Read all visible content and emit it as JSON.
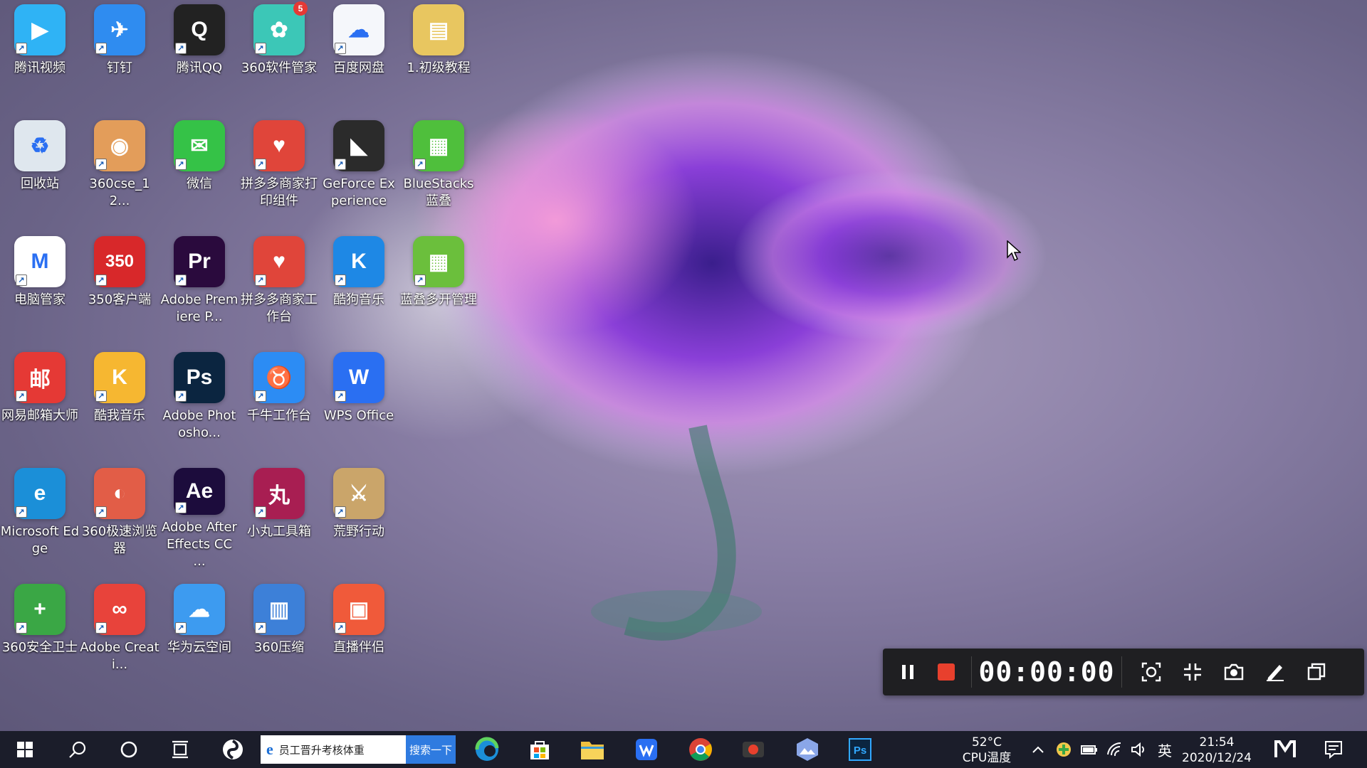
{
  "desktop": {
    "icons": [
      {
        "label": "腾讯视频",
        "glyph": "▶",
        "color": "#2fb3f5",
        "icon": "tencent-video-icon"
      },
      {
        "label": "钉钉",
        "glyph": "✈",
        "color": "#2f8cf0",
        "icon": "dingtalk-icon"
      },
      {
        "label": "腾讯QQ",
        "glyph": "Q",
        "color": "#222222",
        "icon": "qq-penguin-icon"
      },
      {
        "label": "360软件管家",
        "glyph": "✿",
        "color": "#3cc7b7",
        "icon": "360-software-manager-icon",
        "badge": "5"
      },
      {
        "label": "百度网盘",
        "glyph": "☁",
        "color": "#f5f7fb",
        "icon": "baidu-netdisk-icon"
      },
      {
        "label": "1.初级教程",
        "glyph": "▤",
        "color": "#e8c660",
        "icon": "folder-icon"
      },
      {
        "label": "回收站",
        "glyph": "♻",
        "color": "#dfe7ee",
        "icon": "recycle-bin-icon"
      },
      {
        "label": "360cse_12...",
        "glyph": "◉",
        "color": "#e39d5a",
        "icon": "archive-icon"
      },
      {
        "label": "微信",
        "glyph": "✉",
        "color": "#35c247",
        "icon": "wechat-icon"
      },
      {
        "label": "拼多多商家打印组件",
        "glyph": "♥",
        "color": "#e0453a",
        "icon": "pinduoduo-print-icon"
      },
      {
        "label": "GeForce Experience",
        "glyph": "◣",
        "color": "#2b2b2b",
        "icon": "geforce-icon"
      },
      {
        "label": "BlueStacks 蓝叠",
        "glyph": "▦",
        "color": "#4fbf3c",
        "icon": "bluestacks-icon"
      },
      {
        "label": "电脑管家",
        "glyph": "M",
        "color": "#ffffff",
        "icon": "pc-manager-icon"
      },
      {
        "label": "350客户端",
        "glyph": "350",
        "color": "#d8282a",
        "icon": "350-client-icon"
      },
      {
        "label": "Adobe Premiere P...",
        "glyph": "Pr",
        "color": "#2a0a3d",
        "icon": "premiere-icon"
      },
      {
        "label": "拼多多商家工作台",
        "glyph": "♥",
        "color": "#e0453a",
        "icon": "pinduoduo-workbench-icon"
      },
      {
        "label": "酷狗音乐",
        "glyph": "K",
        "color": "#1e88e5",
        "icon": "kugou-music-icon"
      },
      {
        "label": "蓝叠多开管理",
        "glyph": "▦",
        "color": "#6bbf3c",
        "icon": "bluestacks-multi-icon"
      },
      {
        "label": "网易邮箱大师",
        "glyph": "邮",
        "color": "#e53935",
        "icon": "netease-mail-icon"
      },
      {
        "label": "酷我音乐",
        "glyph": "K",
        "color": "#f6b731",
        "icon": "kuwo-music-icon"
      },
      {
        "label": "Adobe Photosho...",
        "glyph": "Ps",
        "color": "#0b2540",
        "icon": "photoshop-icon"
      },
      {
        "label": "千牛工作台",
        "glyph": "♉",
        "color": "#2c8cf4",
        "icon": "qianniu-icon"
      },
      {
        "label": "WPS Office",
        "glyph": "W",
        "color": "#2a6ff2",
        "icon": "wps-office-icon"
      },
      {
        "label": "Microsoft Edge",
        "glyph": "e",
        "color": "#1b8fd8",
        "icon": "edge-icon"
      },
      {
        "label": "360极速浏览器",
        "glyph": "◐",
        "color": "#e25d47",
        "icon": "360-browser-icon"
      },
      {
        "label": "Adobe After Effects CC ...",
        "glyph": "Ae",
        "color": "#1c0c3c",
        "icon": "after-effects-icon"
      },
      {
        "label": "小丸工具箱",
        "glyph": "丸",
        "color": "#a81e52",
        "icon": "xiaowan-toolbox-icon"
      },
      {
        "label": "荒野行动",
        "glyph": "⚔",
        "color": "#caa56a",
        "icon": "knives-out-game-icon"
      },
      {
        "label": "360安全卫士",
        "glyph": "+",
        "color": "#3aa745",
        "icon": "360-security-icon"
      },
      {
        "label": "Adobe Creati...",
        "glyph": "∞",
        "color": "#e8433b",
        "icon": "creative-cloud-icon"
      },
      {
        "label": "华为云空间",
        "glyph": "☁",
        "color": "#3d9bf0",
        "icon": "huawei-cloud-icon"
      },
      {
        "label": "360压缩",
        "glyph": "▥",
        "color": "#3d80d8",
        "icon": "360-zip-icon"
      },
      {
        "label": "直播伴侣",
        "glyph": "▣",
        "color": "#f05a3a",
        "icon": "live-companion-icon"
      }
    ]
  },
  "recorder": {
    "timer": "00:00:00",
    "buttons": [
      "pause-icon",
      "stop-icon",
      "fit-screen-icon",
      "exit-fullscreen-icon",
      "camera-icon",
      "pen-icon",
      "window-icon"
    ]
  },
  "taskbar": {
    "search_query": "员工晋升考核体重",
    "search_button": "搜索一下",
    "temperature": "52°C",
    "temperature_label": "CPU温度",
    "ime": "英",
    "time": "21:54",
    "date": "2020/12/24"
  },
  "colors": {
    "taskbar": "#1b1d2a",
    "recorder": "#1f1f22",
    "stop": "#e8402d",
    "search_button": "#2f7be0"
  }
}
